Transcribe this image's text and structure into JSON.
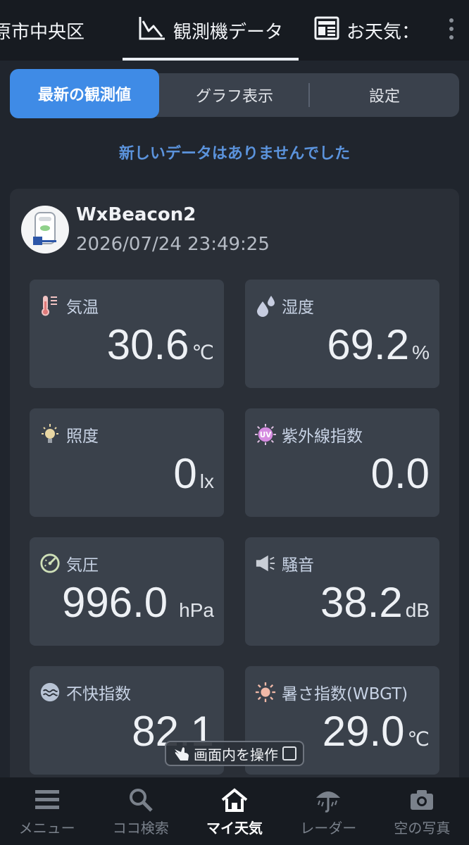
{
  "top_tabs": [
    {
      "label": "原市中央区"
    },
    {
      "label": "観測機データ"
    },
    {
      "label": "お天気："
    }
  ],
  "segments": [
    "最新の観測値",
    "グラフ表示",
    "設定"
  ],
  "notice": "新しいデータはありませんでした",
  "device": {
    "name": "WxBeacon2",
    "timestamp": "2026/07/24 23:49:25"
  },
  "tiles": [
    {
      "label": "気温",
      "value": "30.6",
      "unit": "℃",
      "icon": "thermometer-icon"
    },
    {
      "label": "湿度",
      "value": "69.2",
      "unit": "%",
      "icon": "droplets-icon"
    },
    {
      "label": "照度",
      "value": "0",
      "unit": "lx",
      "icon": "lightbulb-icon"
    },
    {
      "label": "紫外線指数",
      "value": "0.0",
      "unit": "",
      "icon": "uv-icon",
      "icon_text": "UV"
    },
    {
      "label": "気圧",
      "value": "996.0",
      "unit": "hPa",
      "icon": "gauge-icon"
    },
    {
      "label": "騒音",
      "value": "38.2",
      "unit": "dB",
      "icon": "megaphone-icon"
    },
    {
      "label": "不快指数",
      "value": "82.1",
      "unit": "",
      "icon": "discomfort-icon"
    },
    {
      "label": "暑さ指数(WBGT)",
      "value": "29.0",
      "unit": "℃",
      "icon": "sun-icon"
    }
  ],
  "overlay_chip": "画面内を操作",
  "bottom_nav": [
    {
      "label": "メニュー",
      "icon": "menu-icon"
    },
    {
      "label": "ココ検索",
      "icon": "search-icon"
    },
    {
      "label": "マイ天気",
      "icon": "home-icon"
    },
    {
      "label": "レーダー",
      "icon": "umbrella-icon"
    },
    {
      "label": "空の写真",
      "icon": "camera-icon"
    }
  ],
  "colors": {
    "accent": "#3f8be6",
    "notice": "#5b93dc",
    "tile_bg": "#3a414b",
    "label": "#c7d2e4"
  }
}
